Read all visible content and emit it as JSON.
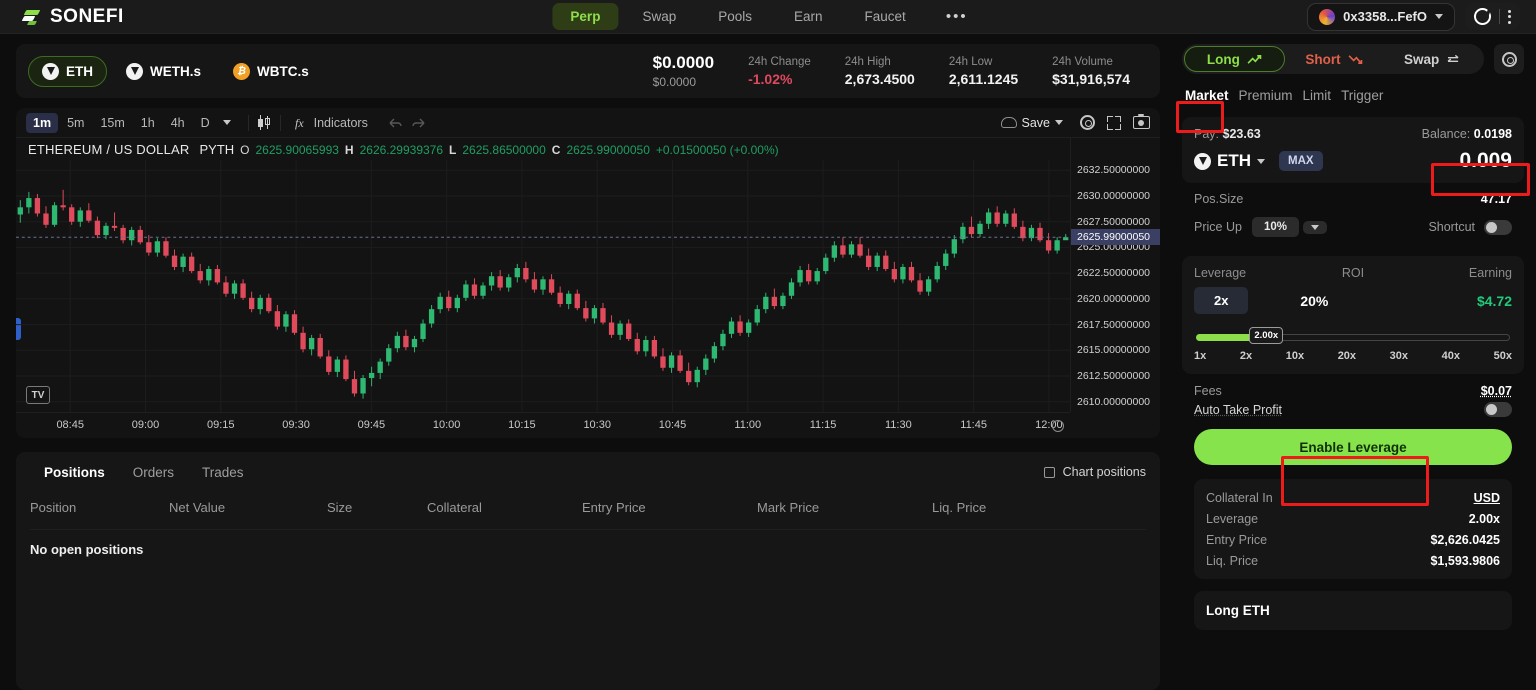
{
  "header": {
    "brand": "SONEFI",
    "brand_logo_icon": "sonefi-logo-icon",
    "nav": [
      {
        "label": "Perp",
        "active": true
      },
      {
        "label": "Swap",
        "active": false
      },
      {
        "label": "Pools",
        "active": false
      },
      {
        "label": "Earn",
        "active": false
      },
      {
        "label": "Faucet",
        "active": false
      }
    ],
    "more_label": "•••",
    "wallet_address": "0x3358...FefO",
    "accent_green": "#8ede4a"
  },
  "market": {
    "tokens": [
      {
        "label": "ETH",
        "icon": "eth-token-icon",
        "active": true
      },
      {
        "label": "WETH.s",
        "icon": "eth-token-icon",
        "active": false
      },
      {
        "label": "WBTC.s",
        "icon": "btc-token-icon",
        "active": false
      }
    ],
    "price_primary": "$0.0000",
    "price_secondary": "$0.0000",
    "stats": [
      {
        "label": "24h Change",
        "value": "-1.02%",
        "negative": true
      },
      {
        "label": "24h High",
        "value": "2,673.4500",
        "negative": false
      },
      {
        "label": "24h Low",
        "value": "2,611.1245",
        "negative": false
      },
      {
        "label": "24h Volume",
        "value": "$31,916,574",
        "negative": false
      }
    ]
  },
  "chart_toolbar": {
    "timeframes": [
      {
        "label": "1m",
        "active": true
      },
      {
        "label": "5m",
        "active": false
      },
      {
        "label": "15m",
        "active": false
      },
      {
        "label": "1h",
        "active": false
      },
      {
        "label": "4h",
        "active": false
      },
      {
        "label": "D",
        "active": false
      }
    ],
    "chart_type_icon": "candlestick-icon",
    "indicators_label": "Indicators",
    "indicators_icon": "fx-icon",
    "undo_icon": "undo-icon",
    "redo_icon": "redo-icon",
    "save_label": "Save",
    "save_icon": "cloud-icon",
    "settings_icon": "gear-icon",
    "fullscreen_icon": "expand-icon",
    "snapshot_icon": "camera-icon"
  },
  "chart_data": {
    "type": "candlestick",
    "title": "ETHEREUM / US DOLLAR",
    "source": "PYTH",
    "legend": {
      "open_label": "O",
      "open": "2625.90065993",
      "high_label": "H",
      "high": "2626.29939376",
      "low_label": "L",
      "low": "2625.86500000",
      "close_label": "C",
      "close": "2625.99000050",
      "change": "+0.01500050 (+0.00%)"
    },
    "ylabel": "",
    "xlabel": "",
    "ylim": [
      2609.0,
      2633.5
    ],
    "yticks": [
      "2632.50000000",
      "2630.00000000",
      "2627.50000000",
      "2625.00000000",
      "2622.50000000",
      "2620.00000000",
      "2617.50000000",
      "2615.00000000",
      "2612.50000000",
      "2610.00000000"
    ],
    "ytick_values": [
      2632.5,
      2630.0,
      2627.5,
      2625.0,
      2622.5,
      2620.0,
      2617.5,
      2615.0,
      2612.5,
      2610.0
    ],
    "current_price_badge": "2625.99000050",
    "current_price_value": 2625.99,
    "xticks": [
      "08:45",
      "09:00",
      "09:15",
      "09:30",
      "09:45",
      "10:00",
      "10:15",
      "10:30",
      "10:45",
      "11:00",
      "11:15",
      "11:30",
      "11:45",
      "12:00"
    ],
    "up_color": "#2eb872",
    "down_color": "#e04b5c",
    "grid": true,
    "candles": [
      [
        2628.2,
        2629.6,
        2627.4,
        2628.9
      ],
      [
        2628.9,
        2630.4,
        2628.3,
        2629.8
      ],
      [
        2629.8,
        2630.2,
        2628.0,
        2628.3
      ],
      [
        2628.3,
        2629.0,
        2626.9,
        2627.2
      ],
      [
        2627.2,
        2629.4,
        2627.0,
        2629.1
      ],
      [
        2629.1,
        2630.6,
        2628.6,
        2628.9
      ],
      [
        2628.9,
        2629.2,
        2627.2,
        2627.5
      ],
      [
        2627.5,
        2628.9,
        2627.0,
        2628.6
      ],
      [
        2628.6,
        2629.3,
        2627.4,
        2627.6
      ],
      [
        2627.6,
        2628.0,
        2625.9,
        2626.2
      ],
      [
        2626.2,
        2627.4,
        2625.8,
        2627.1
      ],
      [
        2627.1,
        2628.4,
        2626.6,
        2626.9
      ],
      [
        2626.9,
        2627.2,
        2625.4,
        2625.7
      ],
      [
        2625.7,
        2627.0,
        2625.2,
        2626.7
      ],
      [
        2626.7,
        2627.1,
        2625.3,
        2625.5
      ],
      [
        2625.5,
        2626.2,
        2624.2,
        2624.5
      ],
      [
        2624.5,
        2625.9,
        2624.1,
        2625.6
      ],
      [
        2625.6,
        2626.0,
        2624.0,
        2624.2
      ],
      [
        2624.2,
        2624.8,
        2622.8,
        2623.1
      ],
      [
        2623.1,
        2624.4,
        2622.6,
        2624.1
      ],
      [
        2624.1,
        2624.5,
        2622.5,
        2622.7
      ],
      [
        2622.7,
        2623.4,
        2621.5,
        2621.8
      ],
      [
        2621.8,
        2623.2,
        2621.3,
        2622.9
      ],
      [
        2622.9,
        2623.3,
        2621.4,
        2621.6
      ],
      [
        2621.6,
        2622.2,
        2620.2,
        2620.5
      ],
      [
        2620.5,
        2621.8,
        2620.0,
        2621.5
      ],
      [
        2621.5,
        2621.9,
        2619.9,
        2620.1
      ],
      [
        2620.1,
        2620.7,
        2618.7,
        2619.0
      ],
      [
        2619.0,
        2620.4,
        2618.5,
        2620.1
      ],
      [
        2620.1,
        2620.5,
        2618.6,
        2618.8
      ],
      [
        2618.8,
        2619.4,
        2617.0,
        2617.3
      ],
      [
        2617.3,
        2618.8,
        2616.8,
        2618.5
      ],
      [
        2618.5,
        2618.9,
        2616.5,
        2616.7
      ],
      [
        2616.7,
        2617.3,
        2614.8,
        2615.1
      ],
      [
        2615.1,
        2616.5,
        2614.5,
        2616.2
      ],
      [
        2616.2,
        2616.6,
        2614.2,
        2614.4
      ],
      [
        2614.4,
        2615.0,
        2612.6,
        2612.9
      ],
      [
        2612.9,
        2614.4,
        2612.4,
        2614.1
      ],
      [
        2614.1,
        2614.5,
        2612.0,
        2612.2
      ],
      [
        2612.2,
        2613.0,
        2610.5,
        2610.8
      ],
      [
        2610.8,
        2612.6,
        2610.3,
        2612.3
      ],
      [
        2612.3,
        2613.4,
        2611.5,
        2612.8
      ],
      [
        2612.8,
        2614.2,
        2612.2,
        2613.9
      ],
      [
        2613.9,
        2615.6,
        2613.5,
        2615.2
      ],
      [
        2615.2,
        2616.8,
        2614.8,
        2616.4
      ],
      [
        2616.4,
        2617.0,
        2615.0,
        2615.3
      ],
      [
        2615.3,
        2616.4,
        2614.8,
        2616.1
      ],
      [
        2616.1,
        2618.0,
        2615.8,
        2617.6
      ],
      [
        2617.6,
        2619.4,
        2617.2,
        2619.0
      ],
      [
        2619.0,
        2620.6,
        2618.6,
        2620.2
      ],
      [
        2620.2,
        2620.8,
        2618.8,
        2619.1
      ],
      [
        2619.1,
        2620.4,
        2618.7,
        2620.1
      ],
      [
        2620.1,
        2621.8,
        2619.8,
        2621.4
      ],
      [
        2621.4,
        2622.0,
        2620.0,
        2620.3
      ],
      [
        2620.3,
        2621.6,
        2620.0,
        2621.3
      ],
      [
        2621.3,
        2622.6,
        2620.8,
        2622.2
      ],
      [
        2622.2,
        2622.8,
        2620.8,
        2621.1
      ],
      [
        2621.1,
        2622.4,
        2620.7,
        2622.1
      ],
      [
        2622.1,
        2623.4,
        2621.6,
        2623.0
      ],
      [
        2623.0,
        2623.6,
        2621.6,
        2621.9
      ],
      [
        2621.9,
        2622.6,
        2620.6,
        2620.9
      ],
      [
        2620.9,
        2622.2,
        2620.4,
        2621.9
      ],
      [
        2621.9,
        2622.4,
        2620.4,
        2620.6
      ],
      [
        2620.6,
        2621.2,
        2619.2,
        2619.5
      ],
      [
        2619.5,
        2620.8,
        2619.0,
        2620.5
      ],
      [
        2620.5,
        2620.9,
        2618.9,
        2619.1
      ],
      [
        2619.1,
        2619.8,
        2617.8,
        2618.1
      ],
      [
        2618.1,
        2619.4,
        2617.6,
        2619.1
      ],
      [
        2619.1,
        2619.6,
        2617.5,
        2617.7
      ],
      [
        2617.7,
        2618.4,
        2616.2,
        2616.5
      ],
      [
        2616.5,
        2617.9,
        2616.0,
        2617.6
      ],
      [
        2617.6,
        2618.0,
        2615.9,
        2616.1
      ],
      [
        2616.1,
        2616.7,
        2614.6,
        2614.9
      ],
      [
        2614.9,
        2616.4,
        2614.4,
        2616.0
      ],
      [
        2616.0,
        2616.4,
        2614.2,
        2614.4
      ],
      [
        2614.4,
        2615.2,
        2613.0,
        2613.3
      ],
      [
        2613.3,
        2614.8,
        2612.8,
        2614.5
      ],
      [
        2614.5,
        2615.0,
        2612.8,
        2613.0
      ],
      [
        2613.0,
        2613.8,
        2611.6,
        2611.9
      ],
      [
        2611.9,
        2613.4,
        2611.4,
        2613.1
      ],
      [
        2613.1,
        2614.6,
        2612.6,
        2614.2
      ],
      [
        2614.2,
        2615.8,
        2613.8,
        2615.4
      ],
      [
        2615.4,
        2617.0,
        2615.0,
        2616.6
      ],
      [
        2616.6,
        2618.2,
        2616.2,
        2617.8
      ],
      [
        2617.8,
        2618.4,
        2616.4,
        2616.7
      ],
      [
        2616.7,
        2618.0,
        2616.3,
        2617.7
      ],
      [
        2617.7,
        2619.4,
        2617.4,
        2619.0
      ],
      [
        2619.0,
        2620.6,
        2618.6,
        2620.2
      ],
      [
        2620.2,
        2621.0,
        2619.0,
        2619.3
      ],
      [
        2619.3,
        2620.6,
        2619.0,
        2620.3
      ],
      [
        2620.3,
        2622.0,
        2620.0,
        2621.6
      ],
      [
        2621.6,
        2623.2,
        2621.2,
        2622.8
      ],
      [
        2622.8,
        2623.4,
        2621.4,
        2621.7
      ],
      [
        2621.7,
        2623.0,
        2621.4,
        2622.7
      ],
      [
        2622.7,
        2624.4,
        2622.4,
        2624.0
      ],
      [
        2624.0,
        2625.6,
        2623.6,
        2625.2
      ],
      [
        2625.2,
        2626.0,
        2624.0,
        2624.3
      ],
      [
        2624.3,
        2625.6,
        2624.0,
        2625.3
      ],
      [
        2625.3,
        2626.0,
        2624.0,
        2624.2
      ],
      [
        2624.2,
        2624.9,
        2622.8,
        2623.1
      ],
      [
        2623.1,
        2624.5,
        2622.7,
        2624.2
      ],
      [
        2624.2,
        2624.7,
        2622.7,
        2622.9
      ],
      [
        2622.9,
        2623.6,
        2621.6,
        2621.9
      ],
      [
        2621.9,
        2623.4,
        2621.5,
        2623.1
      ],
      [
        2623.1,
        2623.6,
        2621.6,
        2621.8
      ],
      [
        2621.8,
        2622.5,
        2620.4,
        2620.7
      ],
      [
        2620.7,
        2622.2,
        2620.3,
        2621.9
      ],
      [
        2621.9,
        2623.6,
        2621.6,
        2623.2
      ],
      [
        2623.2,
        2624.8,
        2622.8,
        2624.4
      ],
      [
        2624.4,
        2626.2,
        2624.0,
        2625.8
      ],
      [
        2625.8,
        2627.4,
        2625.4,
        2627.0
      ],
      [
        2627.0,
        2628.0,
        2626.0,
        2626.3
      ],
      [
        2626.3,
        2627.6,
        2626.0,
        2627.3
      ],
      [
        2627.3,
        2628.8,
        2626.8,
        2628.4
      ],
      [
        2628.4,
        2629.0,
        2627.0,
        2627.3
      ],
      [
        2627.3,
        2628.6,
        2627.0,
        2628.3
      ],
      [
        2628.3,
        2628.8,
        2626.8,
        2627.0
      ],
      [
        2627.0,
        2627.6,
        2625.6,
        2625.9
      ],
      [
        2625.9,
        2627.2,
        2625.6,
        2626.9
      ],
      [
        2626.9,
        2627.4,
        2625.5,
        2625.7
      ],
      [
        2625.7,
        2626.4,
        2624.4,
        2624.7
      ],
      [
        2624.7,
        2626.0,
        2624.4,
        2625.7
      ],
      [
        2625.7,
        2626.3,
        2625.8,
        2625.99
      ]
    ]
  },
  "positions": {
    "tabs": [
      {
        "label": "Positions",
        "active": true
      },
      {
        "label": "Orders",
        "active": false
      },
      {
        "label": "Trades",
        "active": false
      }
    ],
    "chart_positions_label": "Chart positions",
    "columns": [
      "Position",
      "Net Value",
      "Size",
      "Collateral",
      "Entry Price",
      "Mark Price",
      "Liq. Price"
    ],
    "empty_message": "No open positions"
  },
  "trade": {
    "sides": [
      {
        "label": "Long",
        "icon": "trend-up-icon",
        "active": true
      },
      {
        "label": "Short",
        "icon": "trend-down-icon",
        "active": false
      },
      {
        "label": "Swap",
        "icon": "swap-arrows-icon",
        "active": false
      }
    ],
    "settings_icon": "gear-icon",
    "order_tabs": [
      {
        "label": "Market",
        "active": true
      },
      {
        "label": "Premium",
        "active": false
      },
      {
        "label": "Limit",
        "active": false
      },
      {
        "label": "Trigger",
        "active": false
      }
    ],
    "pay_label": "Pay:",
    "pay_value": "$23.63",
    "balance_label": "Balance:",
    "balance_value": "0.0198",
    "pay_token": "ETH",
    "pay_token_icon": "eth-token-icon",
    "max_label": "MAX",
    "amount": "0.009",
    "pos_size_label": "Pos.Size",
    "pos_size_value": "47.17",
    "price_up_label": "Price Up",
    "price_up_value": "10%",
    "shortcut_label": "Shortcut",
    "shortcut_on": false,
    "leverage_label": "Leverage",
    "roi_label": "ROI",
    "earning_label": "Earning",
    "leverage_value": "2x",
    "roi_value": "20%",
    "earning_value": "$4.72",
    "slider_thumb": "2.00x",
    "slider_ticks": [
      "1x",
      "2x",
      "10x",
      "20x",
      "30x",
      "40x",
      "50x"
    ],
    "fees_label": "Fees",
    "fees_value": "$0.07",
    "auto_tp_label": "Auto Take Profit",
    "auto_tp_on": false,
    "cta_label": "Enable Leverage",
    "details": [
      {
        "label": "Collateral In",
        "value": "USD",
        "underline": true
      },
      {
        "label": "Leverage",
        "value": "2.00x",
        "underline": false
      },
      {
        "label": "Entry Price",
        "value": "$2,626.0425",
        "underline": false
      },
      {
        "label": "Liq. Price",
        "value": "$1,593.9806",
        "underline": false
      }
    ],
    "card_title": "Long ETH"
  },
  "highlights": {
    "color": "#ee1b1b",
    "boxes": [
      "market-tab",
      "amount-input",
      "enable-leverage-button"
    ]
  }
}
